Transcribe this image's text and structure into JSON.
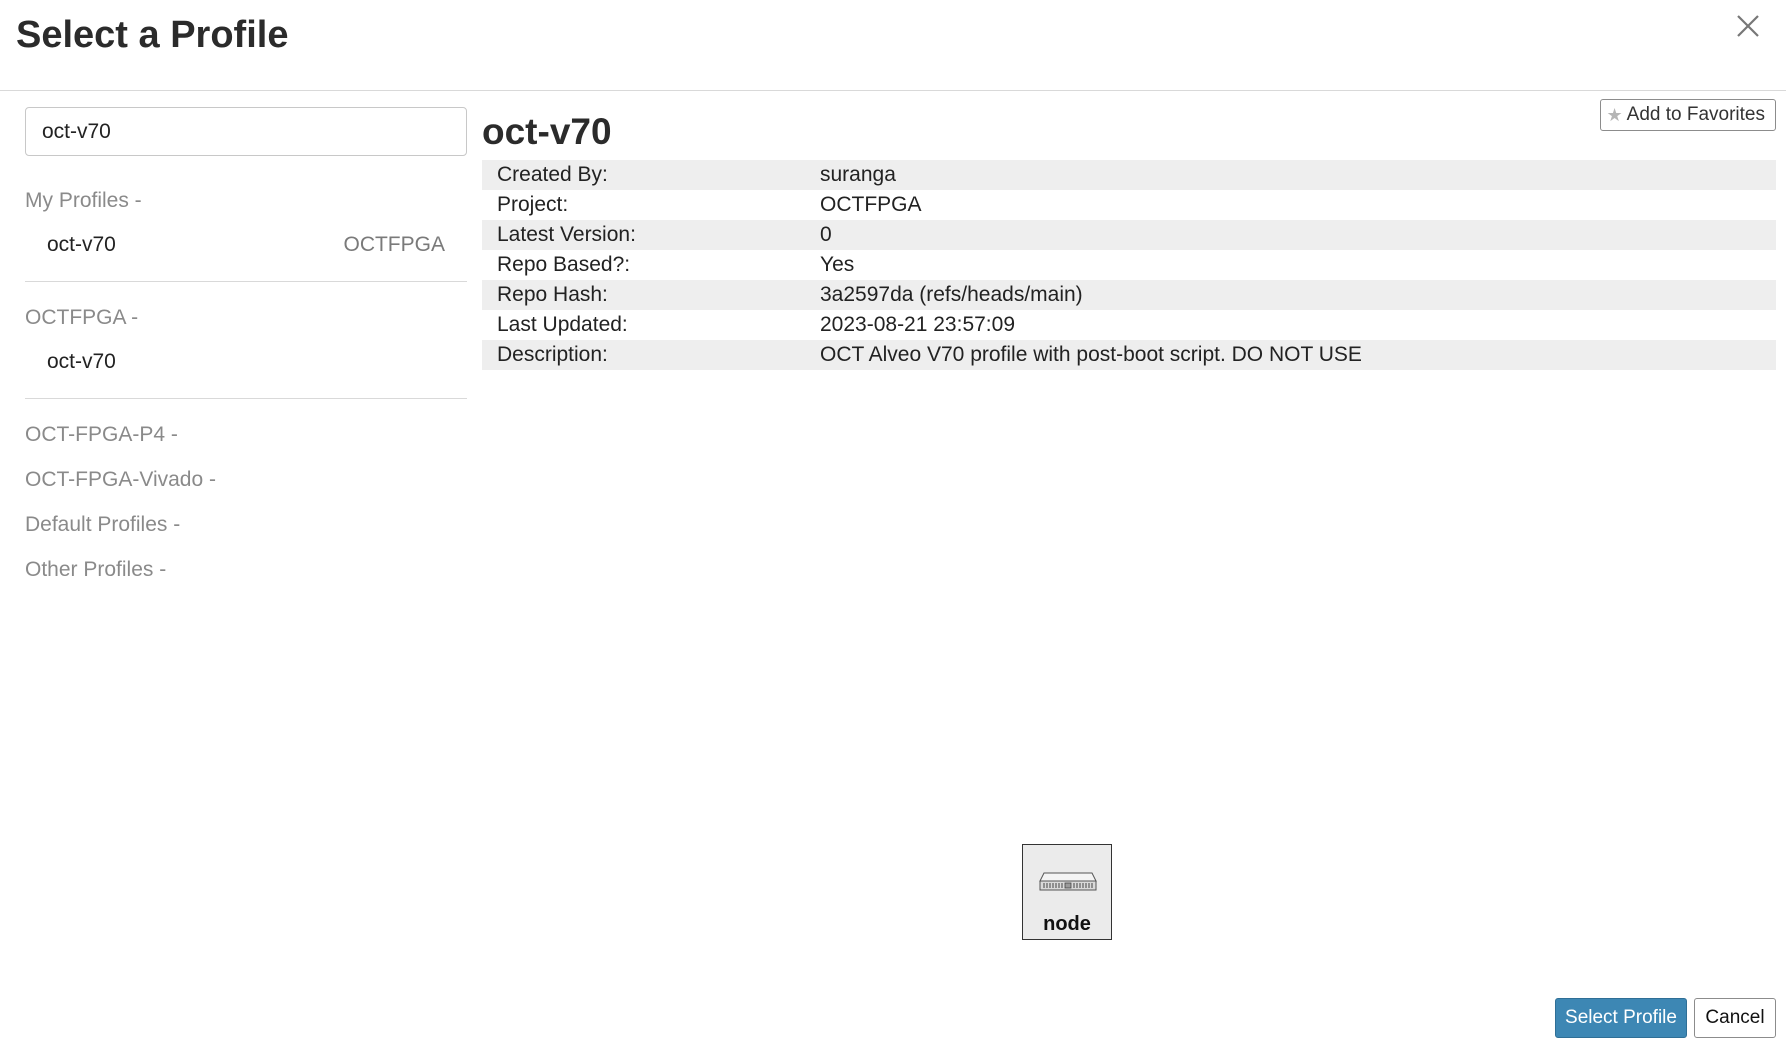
{
  "dialog": {
    "title": "Select a Profile",
    "close_icon": "close-icon"
  },
  "search": {
    "value": "oct-v70"
  },
  "groups": [
    {
      "header": "My Profiles -",
      "items": [
        {
          "name": "oct-v70",
          "project": "OCTFPGA"
        }
      ]
    },
    {
      "header": "OCTFPGA -",
      "items": [
        {
          "name": "oct-v70",
          "project": ""
        }
      ]
    },
    {
      "header": "OCT-FPGA-P4 -"
    },
    {
      "header": "OCT-FPGA-Vivado -"
    },
    {
      "header": "Default Profiles -"
    },
    {
      "header": "Other Profiles -"
    }
  ],
  "details": {
    "title": "oct-v70",
    "favorites_label": "Add to Favorites",
    "favorites_icon": "star-icon",
    "rows": [
      {
        "key": "Created By:",
        "value": "suranga"
      },
      {
        "key": "Project:",
        "value": "OCTFPGA"
      },
      {
        "key": "Latest Version:",
        "value": "0"
      },
      {
        "key": "Repo Based?:",
        "value": "Yes"
      },
      {
        "key": "Repo Hash:",
        "value": "3a2597da (refs/heads/main)"
      },
      {
        "key": "Last Updated:",
        "value": "2023-08-21 23:57:09"
      },
      {
        "key": "Description:",
        "value": "OCT Alveo V70 profile with post-boot script. DO NOT USE"
      }
    ]
  },
  "topology": {
    "node_label": "node",
    "node_icon": "server-icon"
  },
  "footer": {
    "select_label": "Select Profile",
    "cancel_label": "Cancel"
  },
  "colors": {
    "primary_button": "#3d87b4",
    "row_stripe": "#eeeeee",
    "muted_text": "#8a8a8a"
  }
}
